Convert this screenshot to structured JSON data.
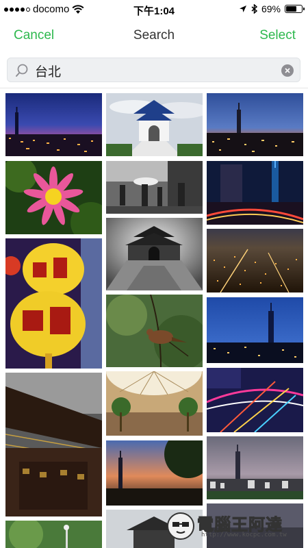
{
  "status_bar": {
    "carrier": "docomo",
    "time": "下午1:04",
    "battery_text": "69%",
    "battery_level": 0.69
  },
  "nav": {
    "cancel_label": "Cancel",
    "title": "Search",
    "select_label": "Select",
    "accent_color": "#2db84d"
  },
  "search": {
    "value": "台北"
  },
  "results": [
    {
      "name": "photo-taipei-night-skyline",
      "icon": "photo-thumbnail"
    },
    {
      "name": "photo-chiang-kai-shek-memorial",
      "icon": "photo-thumbnail"
    },
    {
      "name": "photo-taipei101-dusk",
      "icon": "photo-thumbnail"
    },
    {
      "name": "photo-pink-water-lily",
      "icon": "photo-thumbnail"
    },
    {
      "name": "photo-street-umbrellas-bw",
      "icon": "photo-thumbnail"
    },
    {
      "name": "photo-city-light-trails",
      "icon": "photo-thumbnail"
    },
    {
      "name": "photo-memorial-gate-dramatic",
      "icon": "photo-thumbnail"
    },
    {
      "name": "photo-taipei-aerial-night",
      "icon": "photo-thumbnail"
    },
    {
      "name": "photo-yellow-lanterns",
      "icon": "photo-thumbnail"
    },
    {
      "name": "photo-bird-on-branch",
      "icon": "photo-thumbnail"
    },
    {
      "name": "photo-taipei101-blue-hour",
      "icon": "photo-thumbnail"
    },
    {
      "name": "photo-mall-glass-dome",
      "icon": "photo-thumbnail"
    },
    {
      "name": "photo-interchange-light-trails",
      "icon": "photo-thumbnail"
    },
    {
      "name": "photo-temple-eaves",
      "icon": "photo-thumbnail"
    },
    {
      "name": "photo-taipei101-sunset",
      "icon": "photo-thumbnail"
    },
    {
      "name": "photo-taipei-panorama",
      "icon": "photo-thumbnail"
    },
    {
      "name": "photo-green-lamp",
      "icon": "photo-thumbnail"
    },
    {
      "name": "photo-temple-roof",
      "icon": "photo-thumbnail"
    },
    {
      "name": "photo-skyline-partial",
      "icon": "photo-thumbnail"
    }
  ],
  "watermark": {
    "title": "電腦王阿達",
    "url": "http://www.kocpc.com.tw"
  }
}
